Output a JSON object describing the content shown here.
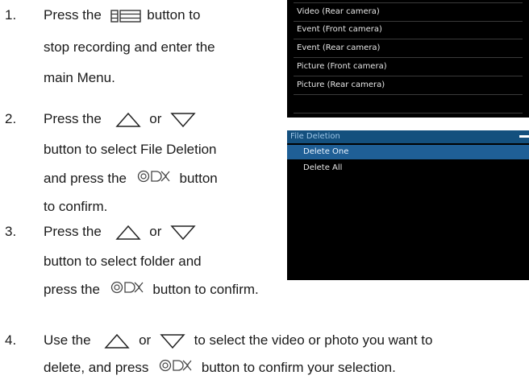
{
  "steps": [
    {
      "num": "1.",
      "lines": [
        "Press the",
        "button to",
        "stop recording and enter the",
        "main Menu."
      ]
    },
    {
      "num": "2.",
      "lines": [
        "Press the",
        "or",
        "button to select File Deletion",
        "and press the",
        "button",
        "to confirm."
      ]
    },
    {
      "num": "3.",
      "lines": [
        "Press the",
        "or",
        "button to select folder and",
        "press the",
        "button to confirm."
      ]
    },
    {
      "num": "4.",
      "lines": [
        "Use the",
        "or",
        "to select the video or photo you want to",
        "delete, and press",
        "button to confirm your selection."
      ]
    }
  ],
  "folder_screen": {
    "items": [
      "Video (Rear camera)",
      "Event (Front camera)",
      "Event (Rear camera)",
      "Picture (Front camera)",
      "Picture (Rear camera)"
    ]
  },
  "deletion_screen": {
    "title": "File Deletion",
    "options": [
      "Delete One",
      "Delete All"
    ],
    "selected_index": 0
  },
  "icons": {
    "menu": "menu-icon",
    "up": "up-triangle-icon",
    "down": "down-triangle-icon",
    "ok": "ok-button-icon"
  },
  "colors": {
    "screen_bg": "#000000",
    "header_bg": "#14507e",
    "selected_bg": "#1f5f96"
  }
}
